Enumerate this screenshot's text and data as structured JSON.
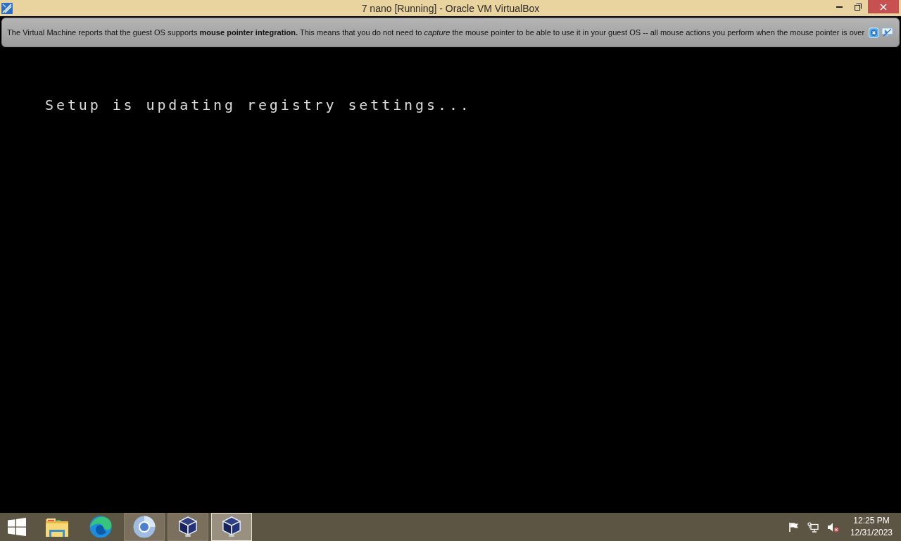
{
  "window": {
    "title": "7 nano [Running] - Oracle VM VirtualBox"
  },
  "notification": {
    "message": "The Virtual Machine reports that the guest OS supports **mouse pointer integration.** This means that you do not need to *capture* the mouse pointer to be able to use it in your guest OS -- all mouse actions you perform when the mouse pointer is over"
  },
  "guest_screen": {
    "text": "Setup is updating registry settings..."
  },
  "taskbar": {
    "items": [
      {
        "kind": "folder",
        "running": false,
        "selected": false
      },
      {
        "kind": "swirl",
        "running": false,
        "selected": false
      },
      {
        "kind": "orb",
        "running": true,
        "selected": false
      },
      {
        "kind": "cube",
        "running": true,
        "selected": false
      },
      {
        "kind": "cube",
        "running": true,
        "selected": true
      }
    ]
  },
  "tray": {
    "volume_muted": true,
    "time": "12:25 PM",
    "date": "12/31/2023"
  }
}
